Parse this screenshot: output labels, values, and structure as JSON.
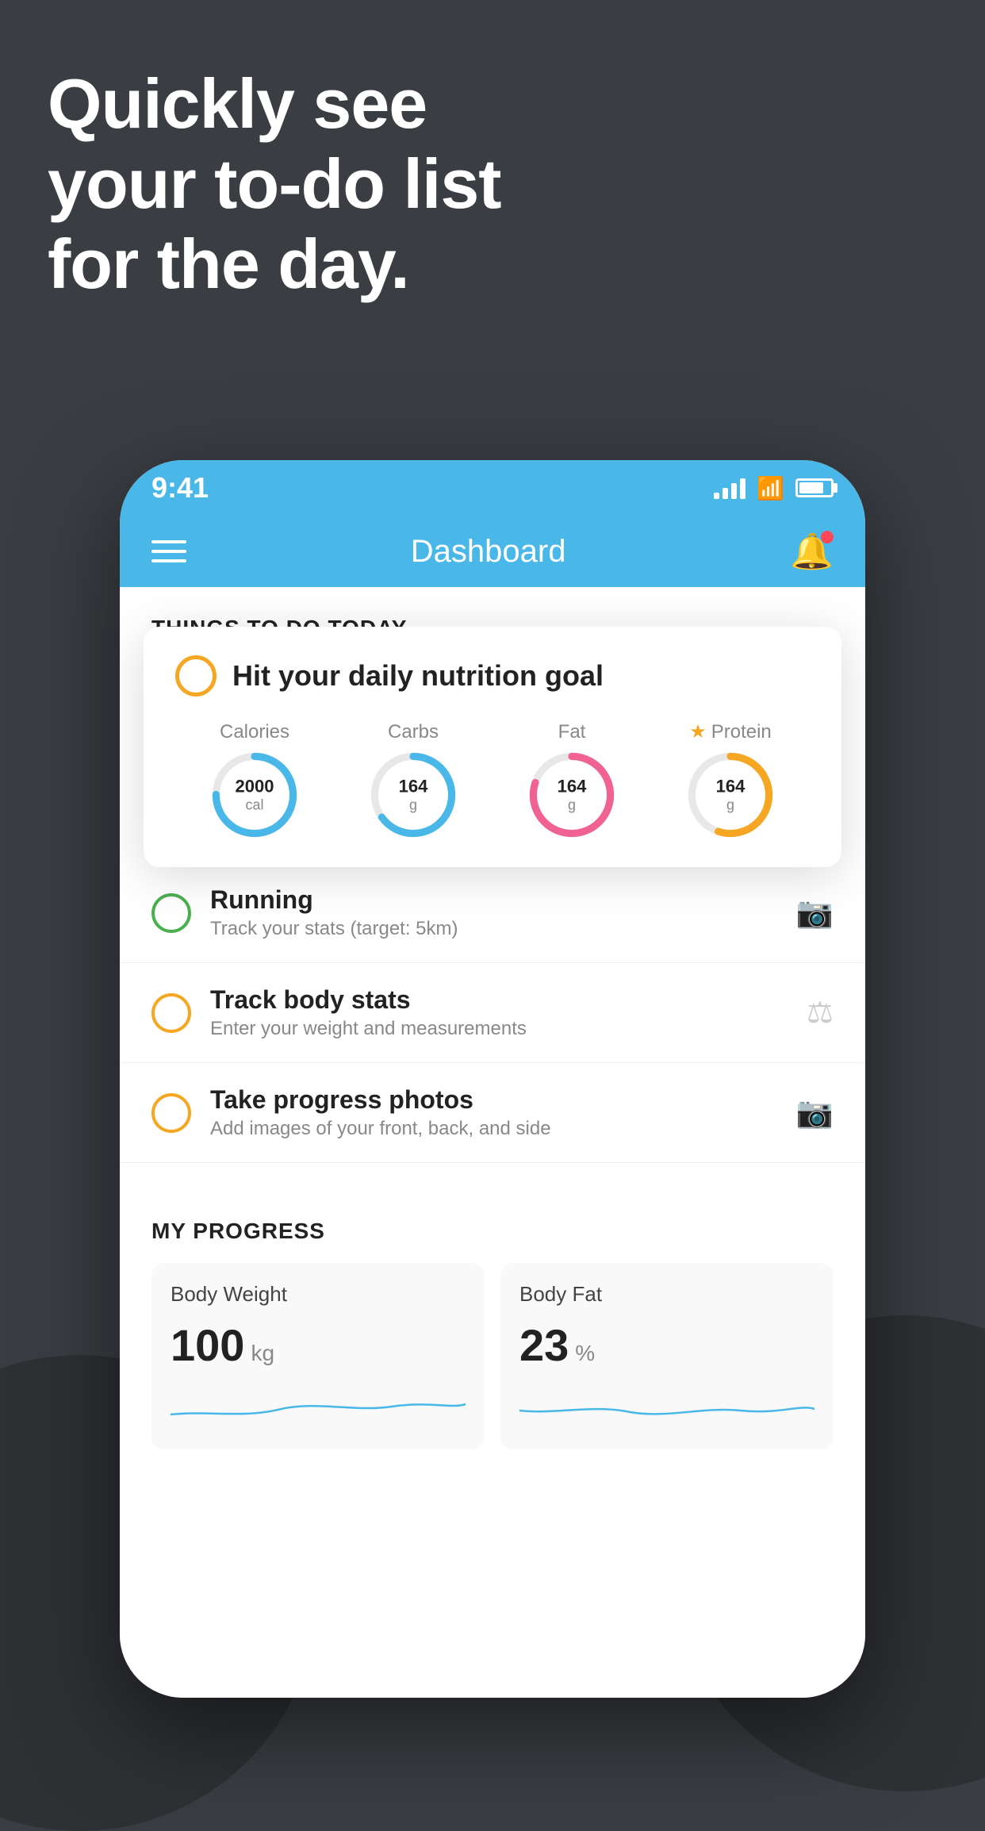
{
  "headline": {
    "line1": "Quickly see",
    "line2": "your to-do list",
    "line3": "for the day."
  },
  "statusBar": {
    "time": "9:41"
  },
  "navBar": {
    "title": "Dashboard"
  },
  "sectionHeader": "THINGS TO DO TODAY",
  "floatingCard": {
    "title": "Hit your daily nutrition goal",
    "macros": [
      {
        "label": "Calories",
        "value": "2000",
        "unit": "cal",
        "color": "#49b8e8",
        "pct": 75,
        "star": false
      },
      {
        "label": "Carbs",
        "value": "164",
        "unit": "g",
        "color": "#49b8e8",
        "pct": 65,
        "star": false
      },
      {
        "label": "Fat",
        "value": "164",
        "unit": "g",
        "color": "#f06292",
        "pct": 80,
        "star": false
      },
      {
        "label": "Protein",
        "value": "164",
        "unit": "g",
        "color": "#f5a623",
        "pct": 55,
        "star": true
      }
    ]
  },
  "todoItems": [
    {
      "label": "Running",
      "sub": "Track your stats (target: 5km)",
      "circleColor": "green",
      "icon": "👟"
    },
    {
      "label": "Track body stats",
      "sub": "Enter your weight and measurements",
      "circleColor": "yellow",
      "icon": "⚖"
    },
    {
      "label": "Take progress photos",
      "sub": "Add images of your front, back, and side",
      "circleColor": "yellow",
      "icon": "🖼"
    }
  ],
  "progress": {
    "title": "MY PROGRESS",
    "cards": [
      {
        "title": "Body Weight",
        "value": "100",
        "unit": "kg"
      },
      {
        "title": "Body Fat",
        "value": "23",
        "unit": "%"
      }
    ]
  }
}
